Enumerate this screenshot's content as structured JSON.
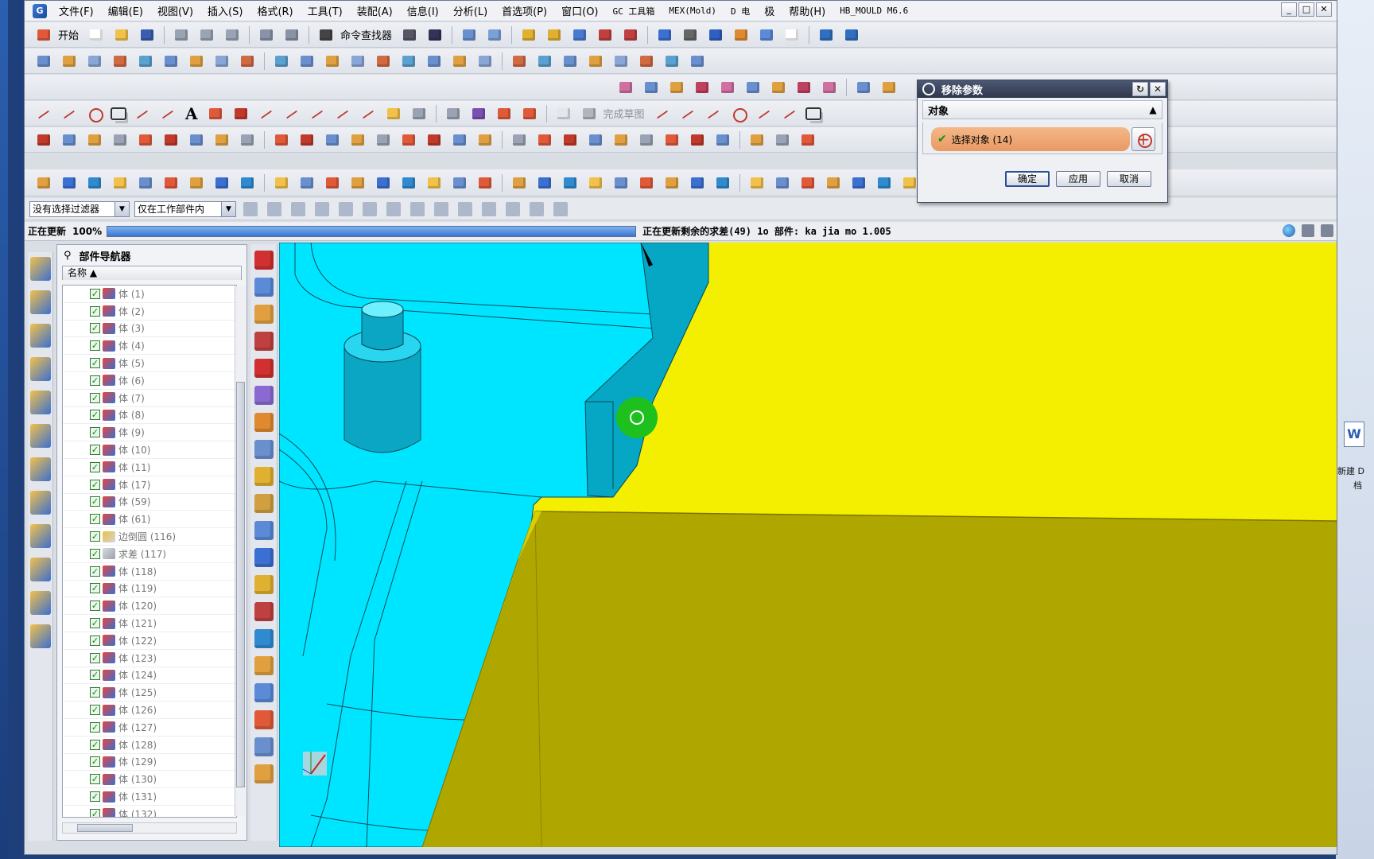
{
  "app": {
    "logo": "G",
    "window_buttons": [
      "_",
      "□",
      "✕"
    ]
  },
  "menu": [
    "文件(F)",
    "编辑(E)",
    "视图(V)",
    "插入(S)",
    "格式(R)",
    "工具(T)",
    "装配(A)",
    "信息(I)",
    "分析(L)",
    "首选项(P)",
    "窗口(O)",
    "GC 工具箱",
    "MEX(Mold)",
    "D 电",
    "极",
    "帮助(H)",
    "HB_MOULD M6.6"
  ],
  "toolbar": {
    "start_label": "开始",
    "command_finder": "命令查找器",
    "finish_sketch": "完成草图",
    "text_tool": "A"
  },
  "filter": {
    "type_filter": "没有选择过滤器",
    "scope_filter": "仅在工作部件内"
  },
  "status": {
    "left": "正在更新",
    "percent": "100%",
    "progress": 1.0,
    "message": "正在更新剩余的求差(49) 1o 部件: ka jia mo 1.005"
  },
  "navigator": {
    "title": "部件导航器",
    "column_name": "名称",
    "rows": [
      {
        "label": "体 (1)",
        "type": "body"
      },
      {
        "label": "体 (2)",
        "type": "body"
      },
      {
        "label": "体 (3)",
        "type": "body"
      },
      {
        "label": "体 (4)",
        "type": "body"
      },
      {
        "label": "体 (5)",
        "type": "body"
      },
      {
        "label": "体 (6)",
        "type": "body"
      },
      {
        "label": "体 (7)",
        "type": "body"
      },
      {
        "label": "体 (8)",
        "type": "body"
      },
      {
        "label": "体 (9)",
        "type": "body"
      },
      {
        "label": "体 (10)",
        "type": "body"
      },
      {
        "label": "体 (11)",
        "type": "body"
      },
      {
        "label": "体 (17)",
        "type": "body"
      },
      {
        "label": "体 (59)",
        "type": "body"
      },
      {
        "label": "体 (61)",
        "type": "body"
      },
      {
        "label": "边倒圆 (116)",
        "type": "blend"
      },
      {
        "label": "求差 (117)",
        "type": "subtract"
      },
      {
        "label": "体 (118)",
        "type": "body"
      },
      {
        "label": "体 (119)",
        "type": "body"
      },
      {
        "label": "体 (120)",
        "type": "body"
      },
      {
        "label": "体 (121)",
        "type": "body"
      },
      {
        "label": "体 (122)",
        "type": "body"
      },
      {
        "label": "体 (123)",
        "type": "body"
      },
      {
        "label": "体 (124)",
        "type": "body"
      },
      {
        "label": "体 (125)",
        "type": "body"
      },
      {
        "label": "体 (126)",
        "type": "body"
      },
      {
        "label": "体 (127)",
        "type": "body"
      },
      {
        "label": "体 (128)",
        "type": "body"
      },
      {
        "label": "体 (129)",
        "type": "body"
      },
      {
        "label": "体 (130)",
        "type": "body"
      },
      {
        "label": "体 (131)",
        "type": "body"
      },
      {
        "label": "体 (132)",
        "type": "body"
      }
    ]
  },
  "dialog": {
    "title": "移除参数",
    "group": "对象",
    "select_label": "选择对象 (14)",
    "ok": "确定",
    "apply": "应用",
    "cancel": "取消"
  },
  "desktop": {
    "file_label": "新建 D",
    "file_label2": "档"
  },
  "colors": {
    "cyan_part": "#00e5ff",
    "yellow_part": "#f4ef00",
    "olive_face": "#b0a600",
    "progress": "#3a77d2",
    "dialog_highlight": "#e89a62"
  }
}
